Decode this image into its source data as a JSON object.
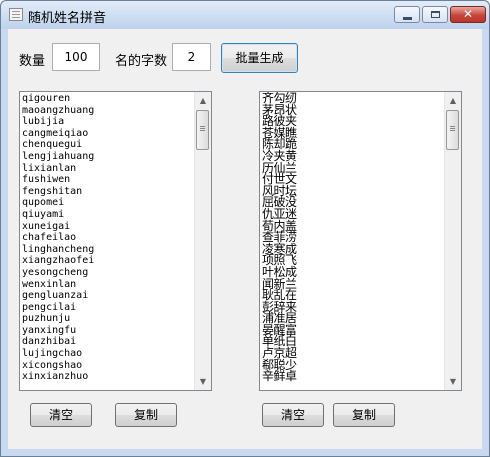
{
  "window": {
    "title": "随机姓名拼音"
  },
  "controls": {
    "count_label": "数量",
    "count_value": "100",
    "name_chars_label": "名的字数",
    "name_chars_value": "2",
    "generate_button": "批量生成"
  },
  "left_panel": {
    "items": [
      "qigouren",
      "maoangzhuang",
      "lubijia",
      "cangmeiqiao",
      "chenquegui",
      "lengjiahuang",
      "lixianlan",
      "fushiwen",
      "fengshitan",
      "qupomei",
      "qiuyami",
      "xuneigai",
      "chafeilao",
      "linghancheng",
      "xiangzhaofei",
      "yesongcheng",
      "wenxinlan",
      "gengluanzai",
      "pengcilai",
      "puzhunju",
      "yanxingfu",
      "danzhibai",
      "lujingchao",
      "xicongshao",
      "xinxianzhuo"
    ],
    "clear_button": "清空",
    "copy_button": "复制"
  },
  "right_panel": {
    "items": [
      "齐勾纫",
      "茅昂状",
      "路彼夹",
      "苍媒瞧",
      "陈却跪",
      "冷夹黄",
      "历仙兰",
      "付世文",
      "风时坛",
      "屈破没",
      "仇亚迷",
      "荀内盖",
      "查菲涝",
      "凌寒成",
      "项照飞",
      "叶松成",
      "闻新兰",
      "耿乱在",
      "彭辞来",
      "浦准居",
      "晏醒富",
      "单纸白",
      "卢京超",
      "郗聪少",
      "辛鲜卓"
    ],
    "clear_button": "清空",
    "copy_button": "复制"
  }
}
